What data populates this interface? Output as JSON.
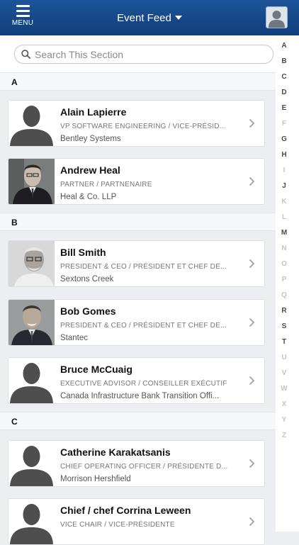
{
  "header": {
    "menu_label": "MENU",
    "title": "Event Feed"
  },
  "search": {
    "placeholder": "Search This Section"
  },
  "index_letters": [
    {
      "letter": "A",
      "active": true
    },
    {
      "letter": "B",
      "active": true
    },
    {
      "letter": "C",
      "active": true
    },
    {
      "letter": "D",
      "active": true
    },
    {
      "letter": "E",
      "active": true
    },
    {
      "letter": "F",
      "active": false
    },
    {
      "letter": "G",
      "active": true
    },
    {
      "letter": "H",
      "active": true
    },
    {
      "letter": "I",
      "active": false
    },
    {
      "letter": "J",
      "active": true
    },
    {
      "letter": "K",
      "active": false
    },
    {
      "letter": "L",
      "active": false
    },
    {
      "letter": "M",
      "active": true
    },
    {
      "letter": "N",
      "active": false
    },
    {
      "letter": "O",
      "active": false
    },
    {
      "letter": "P",
      "active": false
    },
    {
      "letter": "Q",
      "active": false
    },
    {
      "letter": "R",
      "active": true
    },
    {
      "letter": "S",
      "active": true
    },
    {
      "letter": "T",
      "active": true
    },
    {
      "letter": "U",
      "active": false
    },
    {
      "letter": "V",
      "active": false
    },
    {
      "letter": "W",
      "active": false
    },
    {
      "letter": "X",
      "active": false
    },
    {
      "letter": "Y",
      "active": false
    },
    {
      "letter": "Z",
      "active": false
    }
  ],
  "sections": {
    "a": "A",
    "b": "B",
    "c": "C"
  },
  "people": [
    {
      "name": "Alain Lapierre",
      "role": "VP SOFTWARE ENGINEERING / VICE-PRÉSID...",
      "company": "Bentley Systems",
      "photo": "placeholder"
    },
    {
      "name": "Andrew Heal",
      "role": "PARTNER / PARTNENAIRE",
      "company": "Heal & Co. LLP",
      "photo": "photo"
    },
    {
      "name": "Bill Smith",
      "role": "PRESIDENT & CEO / PRÉSIDENT ET CHEF DE...",
      "company": "Sextons Creek",
      "photo": "photo"
    },
    {
      "name": "Bob Gomes",
      "role": "PRESIDENT & CEO / PRÉSIDENT ET CHEF DE...",
      "company": "Stantec",
      "photo": "photo"
    },
    {
      "name": "Bruce McCuaig",
      "role": "EXECUTIVE ADVISOR / CONSEILLER EXÉCUTIF",
      "company": "Canada Infrastructure Bank Transition Offi...",
      "photo": "placeholder"
    },
    {
      "name": "Catherine Karakatsanis",
      "role": "CHIEF OPERATING OFFICER / PRÉSIDENTE D...",
      "company": "Morrison Hershfield",
      "photo": "placeholder"
    },
    {
      "name": "Chief / chef Corrina Leween",
      "role": "VICE CHAIR / VICE-PRÉSIDENTE",
      "company": "",
      "photo": "placeholder"
    }
  ],
  "colors": {
    "header": "#1a4f93",
    "index_active": "#4a4a4a",
    "index_inactive": "#c4c4c4"
  }
}
